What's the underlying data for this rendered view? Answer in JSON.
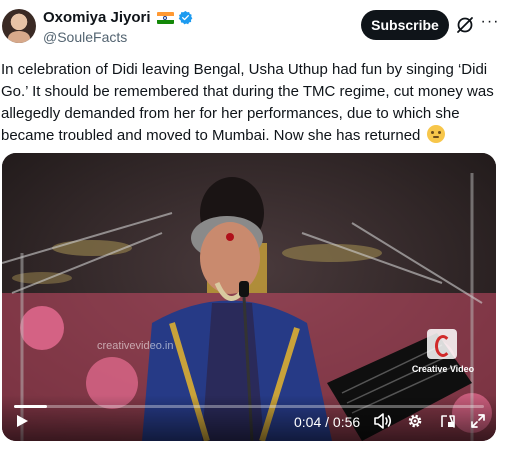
{
  "author": {
    "display_name": "Oxomiya Jiyori",
    "handle": "@SouleFacts",
    "flag_icon": "india-flag-icon",
    "verified_icon": "verified-badge-icon",
    "verified_color": "#1d9bf0"
  },
  "actions": {
    "subscribe_label": "Subscribe",
    "grok_icon": "grok-icon",
    "more_icon": "more-icon"
  },
  "tweet": {
    "text": "In celebration of Didi leaving Bengal, Usha Uthup had fun by singing ‘Didi Go.’ It should be remembered that during the TMC regime, cut money was allegedly demanded from her for her performances, due to which she became troubled and moved to Mumbai. Now she has returned",
    "emoji": "face-with-hand-over-mouth-emoji"
  },
  "video": {
    "watermark_label": "Creative Video",
    "watermark_url_text": "creativevideo.in",
    "current_time": "0:04",
    "duration": "0:56",
    "time_separator": " / ",
    "progress": 0.07,
    "controls": {
      "play_icon": "play-icon",
      "volume_icon": "volume-icon",
      "settings_icon": "gear-icon",
      "pip_icon": "picture-in-picture-icon",
      "fullscreen_icon": "fullscreen-icon"
    }
  }
}
